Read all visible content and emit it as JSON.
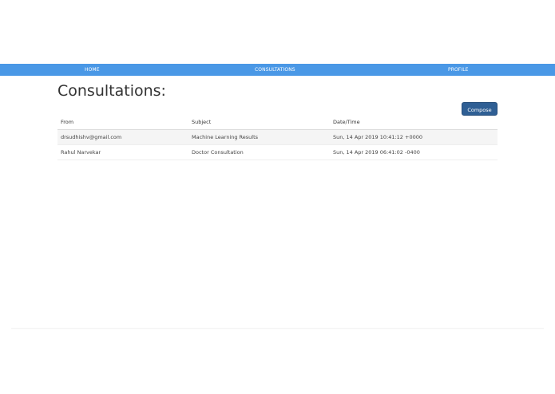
{
  "navbar": {
    "home_label": "HOME",
    "consultations_label": "CONSULTATIONS",
    "profile_label": "PROFILE"
  },
  "main": {
    "title": "Consultations:",
    "compose_label": "Compose"
  },
  "table": {
    "headers": {
      "from": "From",
      "subject": "Subject",
      "date": "Date/Time"
    },
    "rows": [
      {
        "from": "drsudhishv@gmail.com",
        "subject": "Machine Learning Results",
        "date": "Sun, 14 Apr 2019 10:41:12 +0000"
      },
      {
        "from": "Rahul Narvekar",
        "subject": "Doctor Consultation",
        "date": "Sun, 14 Apr 2019 06:41:02 -0400"
      }
    ]
  },
  "colors": {
    "navbar": "#4a98e6",
    "compose_button": "#2f5f94",
    "link": "#3b7bbf"
  }
}
